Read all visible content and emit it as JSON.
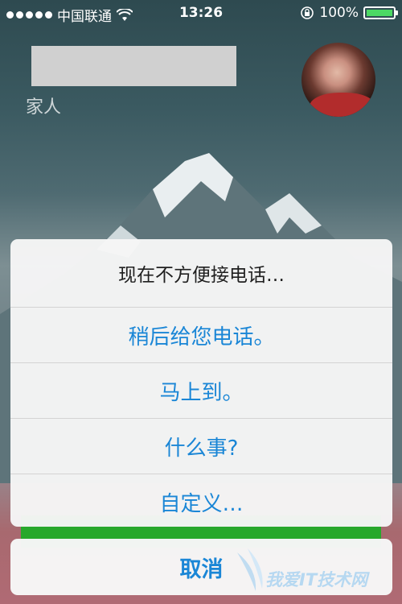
{
  "status_bar": {
    "carrier": "中国联通",
    "time": "13:26",
    "battery": "100%"
  },
  "caller": {
    "label": "家人"
  },
  "action_sheet": {
    "title": "现在不方便接电话…",
    "options": [
      "稍后给您电话。",
      "马上到。",
      "什么事?",
      "自定义…"
    ],
    "cancel": "取消"
  },
  "watermark": {
    "text": "我爱IT技术网"
  },
  "colors": {
    "accent": "#1a86d6",
    "battery": "#4cd964",
    "slide_bar": "#27a82b"
  },
  "icons": [
    "signal-dots-icon",
    "wifi-icon",
    "rotation-lock-icon",
    "battery-icon"
  ]
}
